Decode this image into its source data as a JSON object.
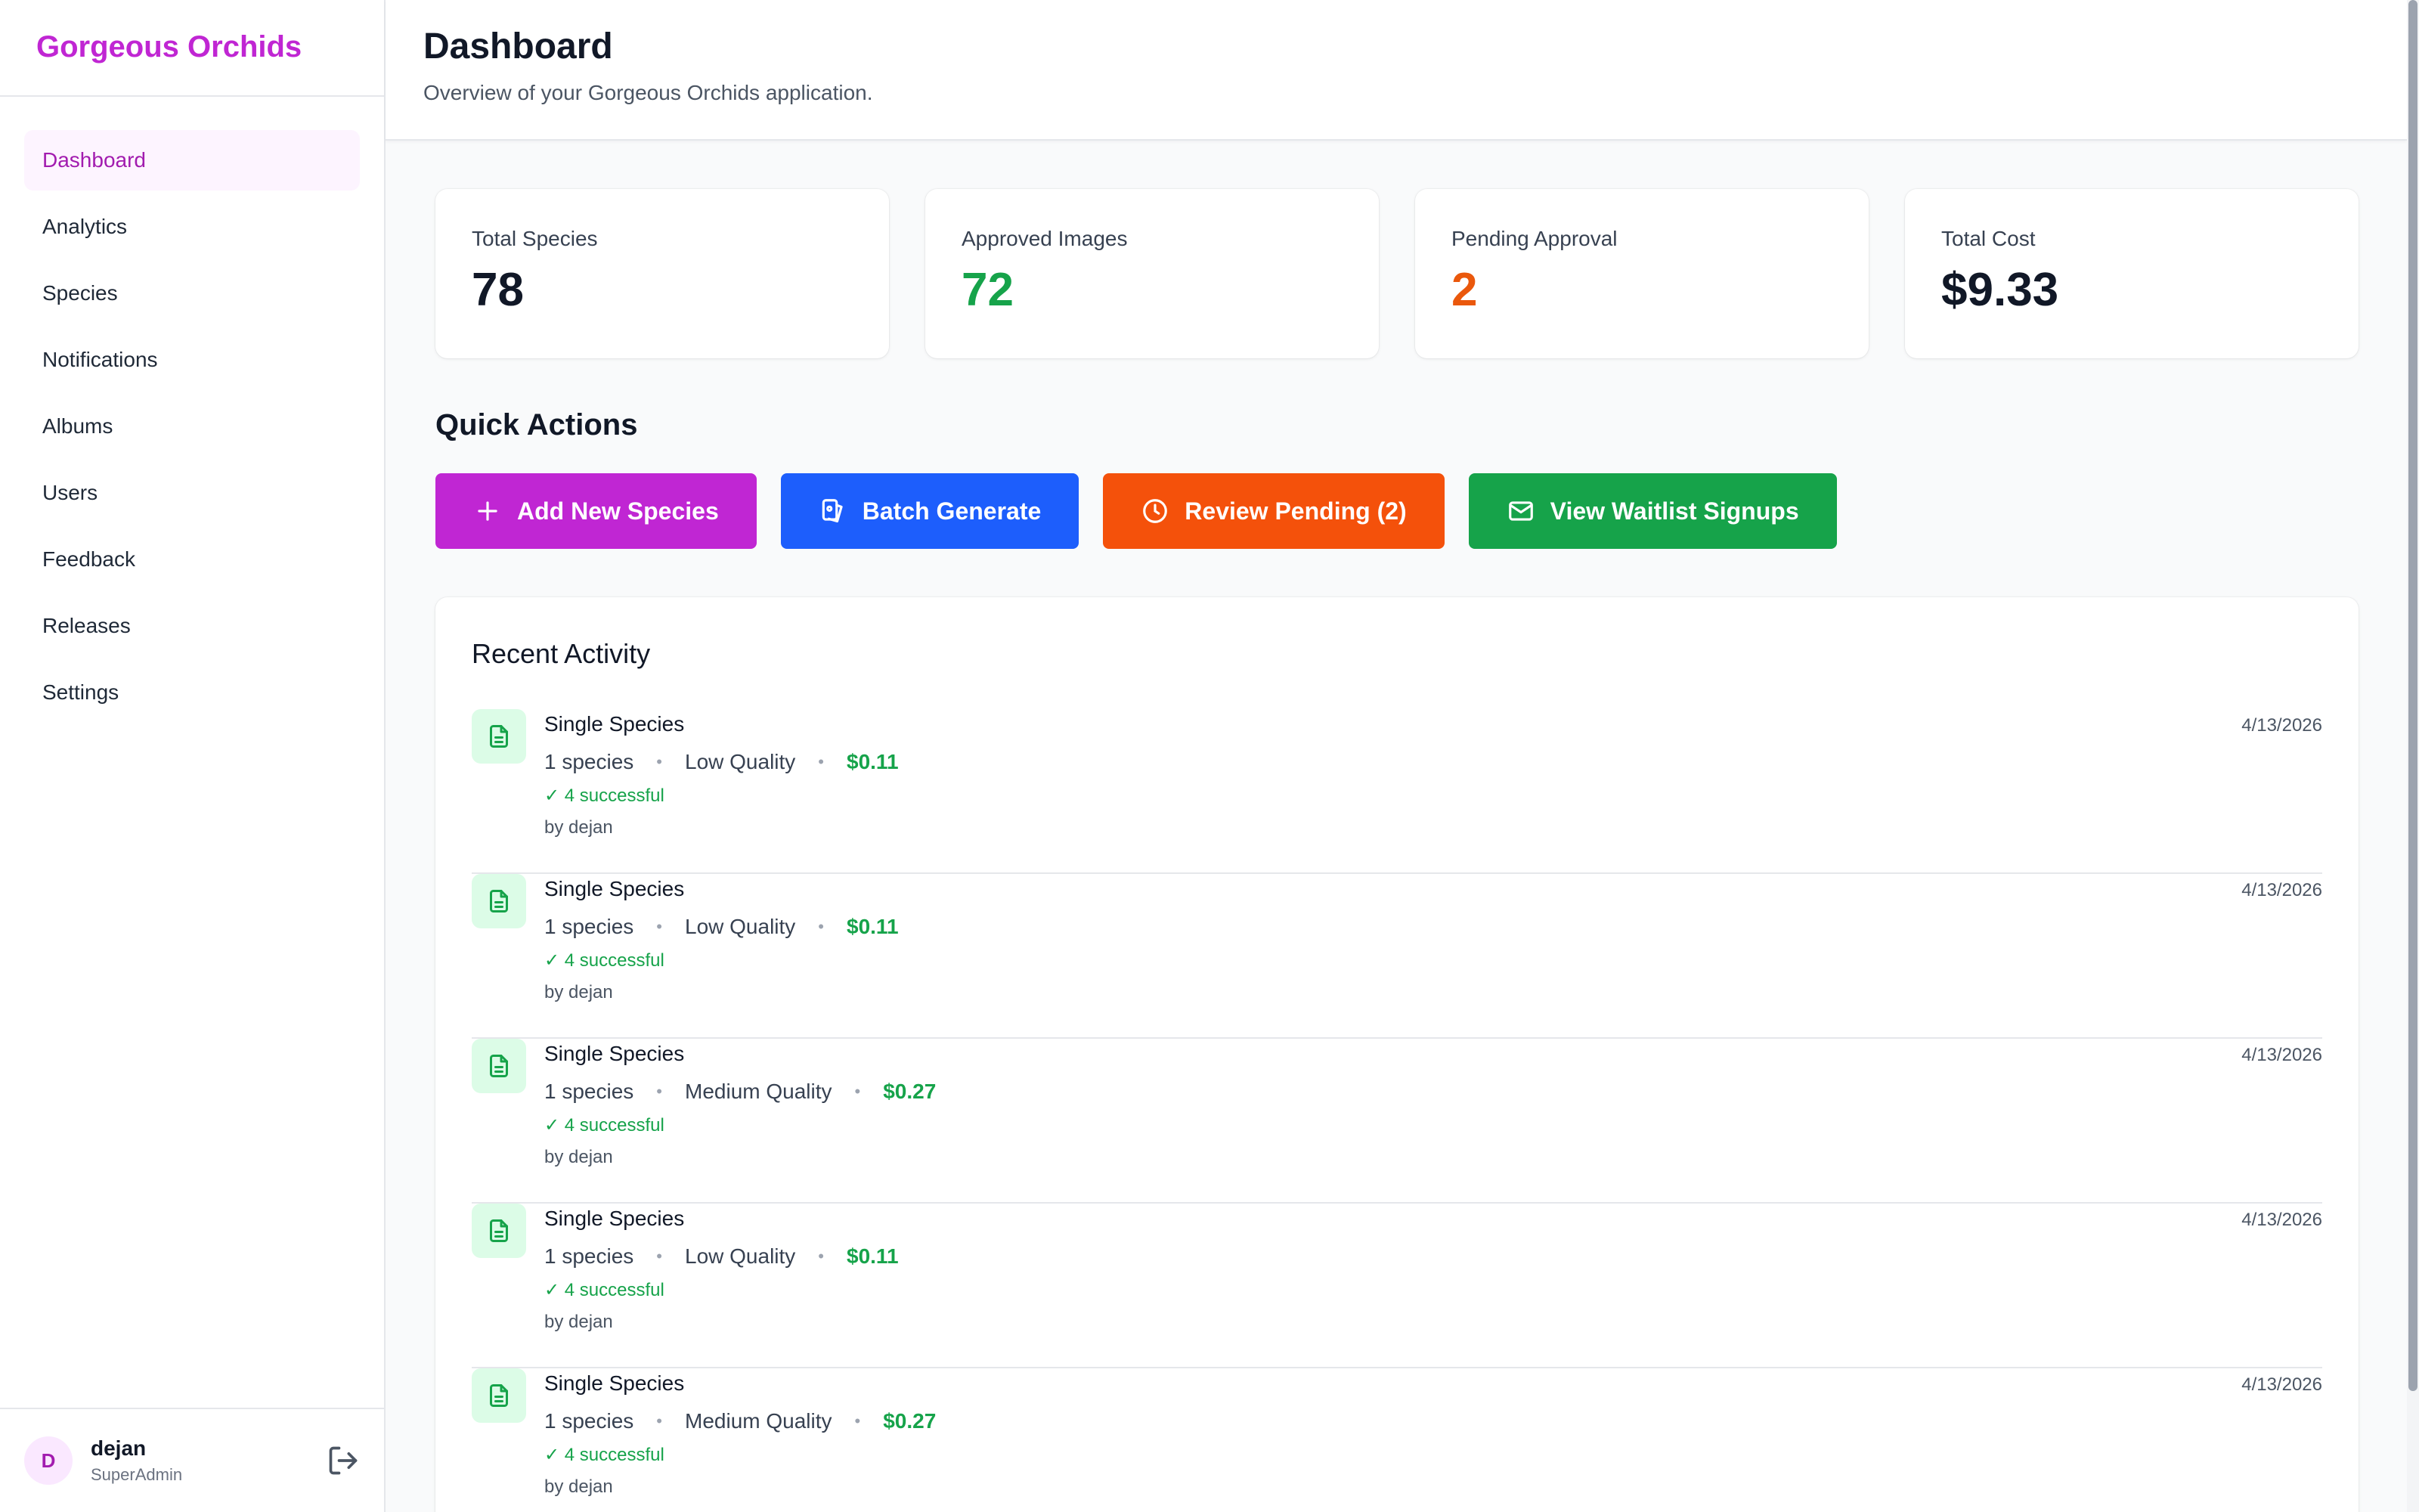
{
  "app": {
    "brand": "Gorgeous Orchids"
  },
  "sidebar": {
    "items": [
      {
        "label": "Dashboard",
        "active": true
      },
      {
        "label": "Analytics"
      },
      {
        "label": "Species"
      },
      {
        "label": "Notifications"
      },
      {
        "label": "Albums"
      },
      {
        "label": "Users"
      },
      {
        "label": "Feedback"
      },
      {
        "label": "Releases"
      },
      {
        "label": "Settings"
      }
    ],
    "user": {
      "initial": "D",
      "name": "dejan",
      "role": "SuperAdmin",
      "logout_icon": "logout-icon"
    }
  },
  "header": {
    "title": "Dashboard",
    "subtitle": "Overview of your Gorgeous Orchids application."
  },
  "stats": [
    {
      "label": "Total Species",
      "value": "78",
      "color": "#111827"
    },
    {
      "label": "Approved Images",
      "value": "72",
      "color": "#16a34a"
    },
    {
      "label": "Pending Approval",
      "value": "2",
      "color": "#ea580c"
    },
    {
      "label": "Total Cost",
      "value": "$9.33",
      "color": "#111827"
    }
  ],
  "quick_actions": {
    "title": "Quick Actions",
    "buttons": [
      {
        "label": "Add New Species",
        "icon": "plus-icon",
        "color": "#c026d3"
      },
      {
        "label": "Batch Generate",
        "icon": "batch-icon",
        "color": "#1d5efc"
      },
      {
        "label": "Review Pending (2)",
        "icon": "clock-icon",
        "color": "#f4510b"
      },
      {
        "label": "View Waitlist Signups",
        "icon": "mail-icon",
        "color": "#16a34a"
      }
    ]
  },
  "activity": {
    "title": "Recent Activity",
    "items": [
      {
        "title": "Single Species",
        "species": "1 species",
        "quality": "Low Quality",
        "cost": "$0.11",
        "success": "✓ 4 successful",
        "by": "by dejan",
        "date": "4/13/2026"
      },
      {
        "title": "Single Species",
        "species": "1 species",
        "quality": "Low Quality",
        "cost": "$0.11",
        "success": "✓ 4 successful",
        "by": "by dejan",
        "date": "4/13/2026"
      },
      {
        "title": "Single Species",
        "species": "1 species",
        "quality": "Medium Quality",
        "cost": "$0.27",
        "success": "✓ 4 successful",
        "by": "by dejan",
        "date": "4/13/2026"
      },
      {
        "title": "Single Species",
        "species": "1 species",
        "quality": "Low Quality",
        "cost": "$0.11",
        "success": "✓ 4 successful",
        "by": "by dejan",
        "date": "4/13/2026"
      },
      {
        "title": "Single Species",
        "species": "1 species",
        "quality": "Medium Quality",
        "cost": "$0.27",
        "success": "✓ 4 successful",
        "by": "by dejan",
        "date": "4/13/2026"
      }
    ],
    "separator": "•"
  },
  "colors": {
    "brand": "#c026d3",
    "active_nav_bg": "#fdf4ff",
    "success": "#16a34a"
  }
}
